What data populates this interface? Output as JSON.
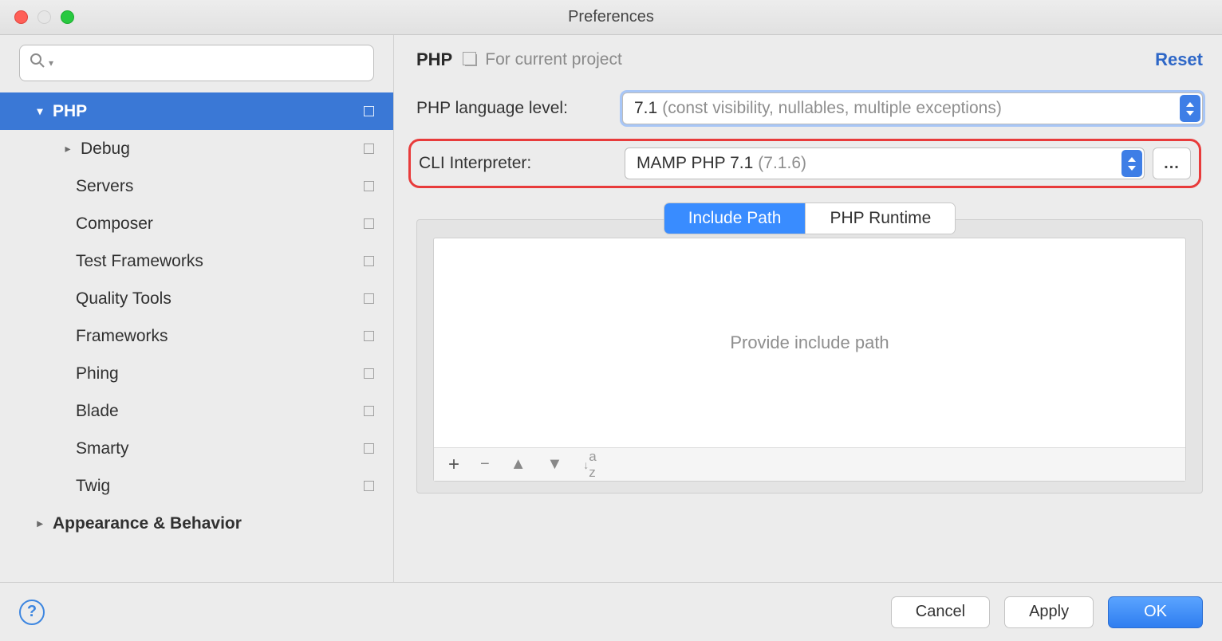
{
  "window": {
    "title": "Preferences"
  },
  "sidebar": {
    "search_placeholder": "",
    "items": [
      {
        "label": "PHP",
        "level": 0,
        "bold": true,
        "arrow": "down",
        "selected": true,
        "proj": true
      },
      {
        "label": "Debug",
        "level": 1,
        "bold": false,
        "arrow": "right",
        "selected": false,
        "proj": true,
        "sub": true
      },
      {
        "label": "Servers",
        "level": 2,
        "bold": false,
        "arrow": "",
        "selected": false,
        "proj": true
      },
      {
        "label": "Composer",
        "level": 2,
        "bold": false,
        "arrow": "",
        "selected": false,
        "proj": true
      },
      {
        "label": "Test Frameworks",
        "level": 2,
        "bold": false,
        "arrow": "",
        "selected": false,
        "proj": true
      },
      {
        "label": "Quality Tools",
        "level": 2,
        "bold": false,
        "arrow": "",
        "selected": false,
        "proj": true
      },
      {
        "label": "Frameworks",
        "level": 2,
        "bold": false,
        "arrow": "",
        "selected": false,
        "proj": true
      },
      {
        "label": "Phing",
        "level": 2,
        "bold": false,
        "arrow": "",
        "selected": false,
        "proj": true
      },
      {
        "label": "Blade",
        "level": 2,
        "bold": false,
        "arrow": "",
        "selected": false,
        "proj": true
      },
      {
        "label": "Smarty",
        "level": 2,
        "bold": false,
        "arrow": "",
        "selected": false,
        "proj": true
      },
      {
        "label": "Twig",
        "level": 2,
        "bold": false,
        "arrow": "",
        "selected": false,
        "proj": true
      },
      {
        "label": "Appearance & Behavior",
        "level": 0,
        "bold": true,
        "arrow": "right",
        "selected": false,
        "proj": false
      }
    ]
  },
  "panel": {
    "title": "PHP",
    "scope": "For current project",
    "reset": "Reset",
    "lang_level_label": "PHP language level:",
    "lang_level_value": "7.1",
    "lang_level_hint": "(const visibility, nullables, multiple exceptions)",
    "cli_label": "CLI Interpreter:",
    "cli_value": "MAMP PHP 7.1",
    "cli_hint": "(7.1.6)",
    "more": "...",
    "tabs": {
      "a": "Include Path",
      "b": "PHP Runtime"
    },
    "include_placeholder": "Provide include path"
  },
  "footer": {
    "cancel": "Cancel",
    "apply": "Apply",
    "ok": "OK"
  }
}
